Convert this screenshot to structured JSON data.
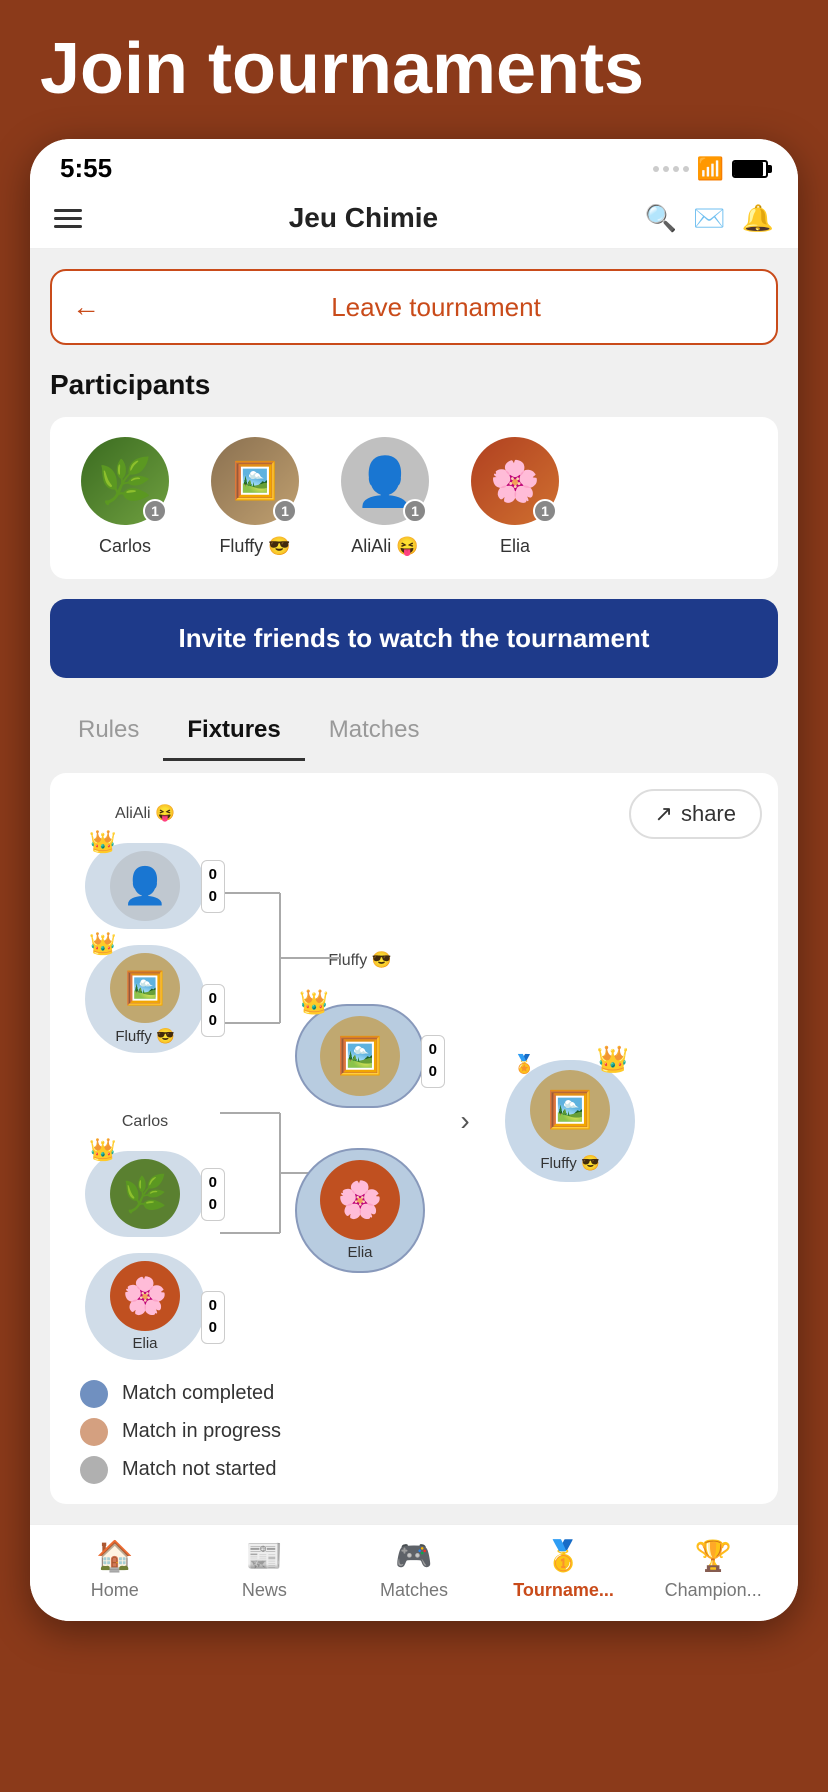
{
  "page": {
    "header_title": "Join tournaments",
    "status_time": "5:55",
    "app_title": "Jeu Chimie"
  },
  "navbar": {
    "title": "Jeu Chimie",
    "search_label": "search",
    "message_label": "message",
    "bell_label": "bell"
  },
  "leave_tournament": {
    "label": "Leave tournament"
  },
  "participants": {
    "section_title": "Participants",
    "items": [
      {
        "name": "Carlos",
        "badge": "1",
        "emoji": "🌿"
      },
      {
        "name": "Fluffy 😎",
        "badge": "1",
        "emoji": "🖼"
      },
      {
        "name": "AliAli 😝",
        "badge": "1",
        "emoji": "👤"
      },
      {
        "name": "Elia",
        "badge": "1",
        "emoji": "🌸"
      }
    ]
  },
  "invite_btn": {
    "label": "Invite friends to watch the tournament"
  },
  "tabs": {
    "rules": "Rules",
    "fixtures": "Fixtures",
    "matches": "Matches",
    "active": "Fixtures"
  },
  "fixtures": {
    "share_btn": "share",
    "bracket": {
      "round1": [
        {
          "top": {
            "name": "AliAli 😝",
            "score": "0\n0"
          },
          "bottom": {
            "name": "Fluffy 😎",
            "score": "0\n0"
          }
        },
        {
          "top": {
            "name": "Carlos",
            "score": "0\n0"
          },
          "bottom": {
            "name": "Elia",
            "score": "0\n0"
          }
        }
      ],
      "round2": {
        "name": "Fluffy 😎",
        "opponent": "Elia",
        "score": "0\n0",
        "crowned": true
      },
      "winner": {
        "name": "Fluffy 😎",
        "crowned": true
      }
    },
    "legend": [
      {
        "color": "blue",
        "label": "Match completed"
      },
      {
        "color": "peach",
        "label": "Match in progress"
      },
      {
        "color": "gray",
        "label": "Match not started"
      }
    ]
  },
  "bottom_nav": {
    "items": [
      {
        "id": "home",
        "icon": "🏠",
        "label": "Home",
        "active": false
      },
      {
        "id": "news",
        "icon": "📰",
        "label": "News",
        "active": false
      },
      {
        "id": "matches",
        "icon": "🎮",
        "label": "Matches",
        "active": false
      },
      {
        "id": "tournament",
        "icon": "🥇",
        "label": "Tourname...",
        "active": true
      },
      {
        "id": "champion",
        "icon": "🏆",
        "label": "Champion...",
        "active": false
      }
    ]
  }
}
